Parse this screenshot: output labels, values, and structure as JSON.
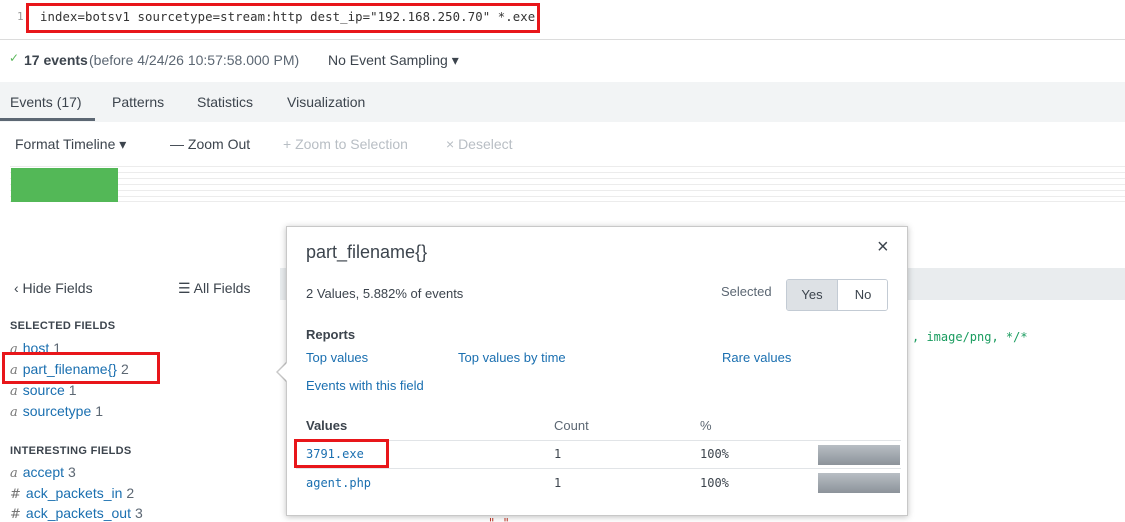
{
  "search": {
    "line_number": "1",
    "query": "index=botsv1 sourcetype=stream:http dest_ip=\"192.168.250.70\" *.exe"
  },
  "summary": {
    "check_icon": "✓",
    "event_count": "17 events",
    "before_text": "(before 4/24/26 10:57:58.000 PM)",
    "sampling": "No Event Sampling ▾"
  },
  "tabs": {
    "events": "Events (17)",
    "patterns": "Patterns",
    "statistics": "Statistics",
    "visualization": "Visualization"
  },
  "timeline_toolbar": {
    "format": "Format Timeline ▾",
    "zoom_out": "— Zoom Out",
    "zoom_selection": "+ Zoom to Selection",
    "deselect": "× Deselect"
  },
  "sidebar": {
    "hide_fields": "‹ Hide Fields",
    "all_fields": "☰ All Fields",
    "selected_title": "SELECTED FIELDS",
    "selected": [
      {
        "type": "a",
        "name": "host",
        "count": "1"
      },
      {
        "type": "a",
        "name": "part_filename{}",
        "count": "2"
      },
      {
        "type": "a",
        "name": "source",
        "count": "1"
      },
      {
        "type": "a",
        "name": "sourcetype",
        "count": "1"
      }
    ],
    "interesting_title": "INTERESTING FIELDS",
    "interesting": [
      {
        "type": "a",
        "name": "accept",
        "count": "3"
      },
      {
        "type": "#",
        "name": "ack_packets_in",
        "count": "2"
      },
      {
        "type": "#",
        "name": "ack_packets_out",
        "count": "3"
      }
    ]
  },
  "event_snippet": ", image/png, */*",
  "event_snippet2": "\"      \"",
  "popup": {
    "title": "part_filename{}",
    "close_icon": "×",
    "stats": "2 Values, 5.882% of events",
    "selected_label": "Selected",
    "yes": "Yes",
    "no": "No",
    "reports_label": "Reports",
    "reports": {
      "top_values": "Top values",
      "top_values_time": "Top values by time",
      "rare_values": "Rare values",
      "events_with_field": "Events with this field"
    },
    "values_header": "Values",
    "count_header": "Count",
    "pct_header": "%",
    "values": [
      {
        "name": "3791.exe",
        "count": "1",
        "pct": "100%",
        "fraction": 1.0
      },
      {
        "name": "agent.php",
        "count": "1",
        "pct": "100%",
        "fraction": 1.0
      }
    ]
  },
  "colors": {
    "highlight_red": "#e8161a",
    "timeline_green": "#53b857",
    "link_blue": "#1a6fb0"
  }
}
